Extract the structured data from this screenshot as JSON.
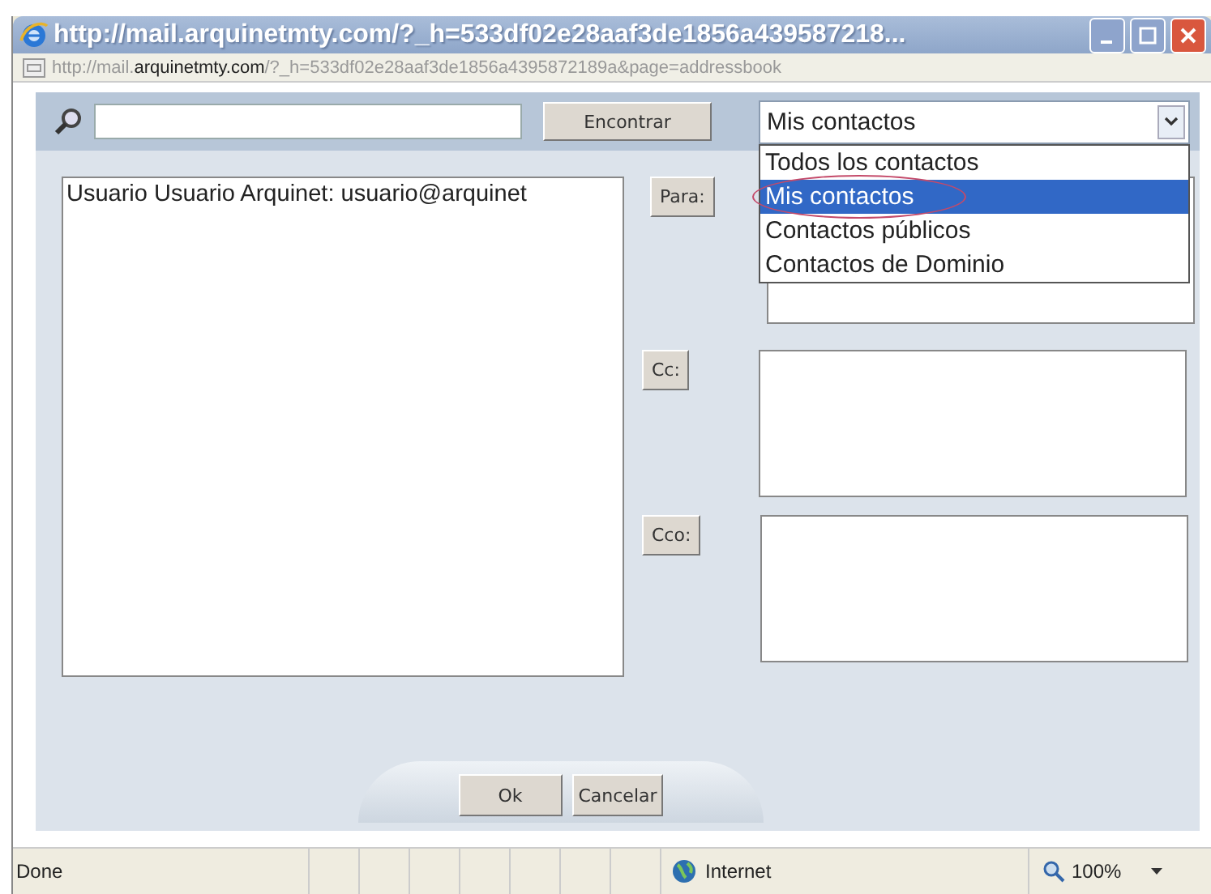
{
  "window": {
    "title": "http://mail.arquinetmty.com/?_h=533df02e28aaf3de1856a439587218..."
  },
  "address_bar": {
    "parts": [
      {
        "text": "http://mail.",
        "kind": "dim"
      },
      {
        "text": "arquinetmty.com",
        "kind": "strong"
      },
      {
        "text": "/?_h=533df02e28aaf3de1856a4395872189a&page=addressbook",
        "kind": "dim"
      }
    ]
  },
  "search": {
    "button": "Encontrar"
  },
  "source_select": {
    "value": "Mis contactos",
    "expanded": true,
    "options": [
      {
        "label": "Todos los contactos",
        "selected": false
      },
      {
        "label": "Mis contactos",
        "selected": true
      },
      {
        "label": "Contactos públicos",
        "selected": false
      },
      {
        "label": "Contactos de Dominio",
        "selected": false
      }
    ]
  },
  "contacts": [
    {
      "label": "Usuario Usuario Arquinet: usuario@arquinet"
    }
  ],
  "recipients": [
    {
      "button": "Para:"
    },
    {
      "button": "Cc:"
    },
    {
      "button": "Cco:"
    }
  ],
  "buttons": [
    {
      "label": "Ok",
      "kind": "primary"
    },
    {
      "label": "Cancelar",
      "kind": "normal"
    }
  ],
  "status_bar": {
    "status": "Done",
    "zone": "Internet",
    "zoom": "100%"
  }
}
